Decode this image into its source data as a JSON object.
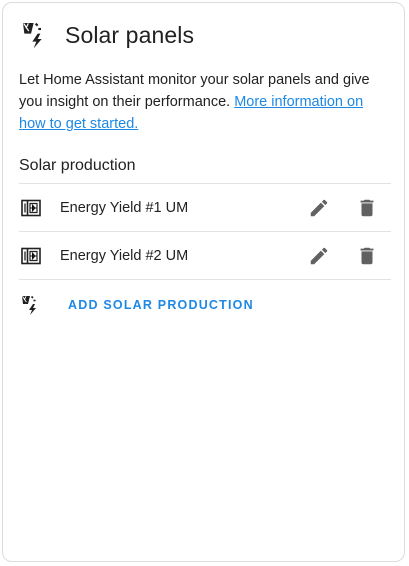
{
  "card": {
    "title": "Solar panels",
    "title_icon": "solar-power-icon",
    "description": "Let Home Assistant monitor your solar panels and give you insight on their performance. ",
    "link_text": "More information on how to get started."
  },
  "section": {
    "title": "Solar production",
    "items": [
      {
        "label": "Energy Yield #1 UM",
        "icon": "solar-panel-icon"
      },
      {
        "label": "Energy Yield #2 UM",
        "icon": "solar-panel-icon"
      }
    ]
  },
  "actions": {
    "edit_icon": "pencil-icon",
    "delete_icon": "trash-icon",
    "add_label": "ADD SOLAR PRODUCTION",
    "add_icon": "solar-power-icon"
  },
  "colors": {
    "accent": "#1e88e5",
    "text": "#212121",
    "icon": "#616161",
    "divider": "#e2e2e2"
  }
}
